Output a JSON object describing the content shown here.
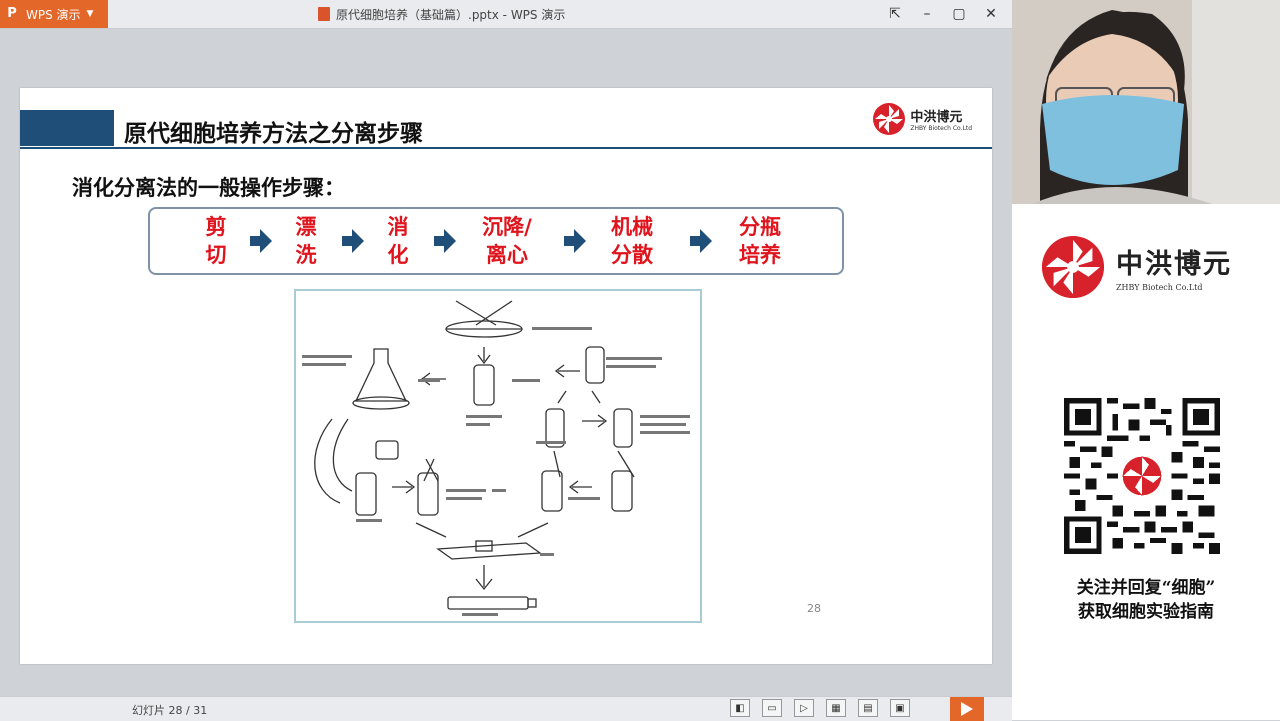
{
  "window": {
    "app_tab_label": "WPS 演示",
    "app_logo": "P",
    "document_title": "原代细胞培养（基础篇）.pptx - WPS 演示"
  },
  "slide": {
    "title": "原代细胞培养方法之分离步骤",
    "brand_cn": "中洪博元",
    "brand_en": "ZHBY Biotech Co.Ltd",
    "subtitle": "消化分离法的一般操作步骤：",
    "steps": [
      {
        "line1": "剪",
        "line2": "切"
      },
      {
        "line1": "漂",
        "line2": "洗"
      },
      {
        "line1": "消",
        "line2": "化"
      },
      {
        "line1": "沉降/",
        "line2": "离心"
      },
      {
        "line1": "机械",
        "line2": "分散"
      },
      {
        "line1": "分瓶",
        "line2": "培养"
      }
    ],
    "page_number": "28"
  },
  "statusbar": {
    "slide_counter": "幻灯片 28 / 31"
  },
  "promo": {
    "brand_cn": "中洪博元",
    "brand_en": "ZHBY Biotech Co.Ltd",
    "line1": "关注并回复“细胞”",
    "line2": "获取细胞实验指南"
  },
  "colors": {
    "accent_orange": "#e4672a",
    "slide_blue": "#1f4e79",
    "step_red": "#e0141c",
    "brand_red": "#d7212b"
  }
}
